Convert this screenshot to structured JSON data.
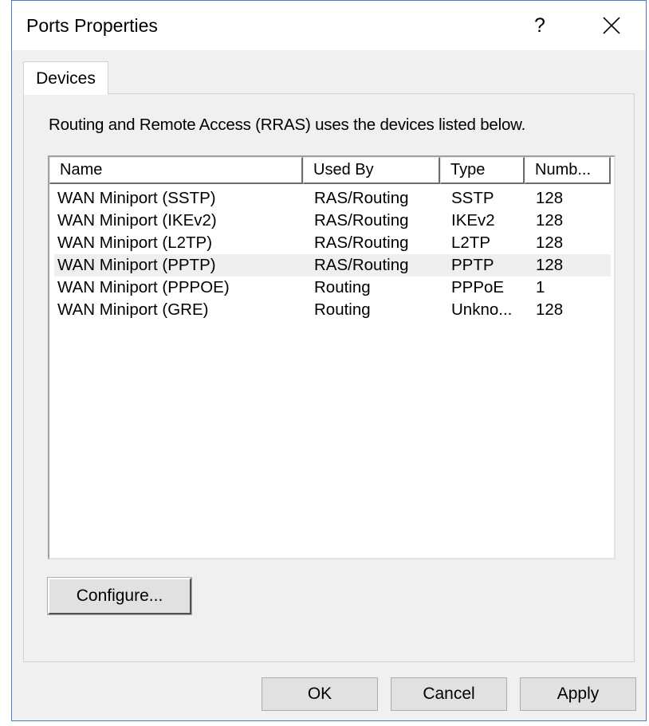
{
  "window": {
    "title": "Ports Properties",
    "help_label": "?"
  },
  "tabs": [
    {
      "label": "Devices",
      "active": true
    }
  ],
  "devices_panel": {
    "description": "Routing and Remote Access (RRAS) uses the devices listed below.",
    "columns": [
      "Name",
      "Used By",
      "Type",
      "Numb..."
    ],
    "rows": [
      {
        "name": "WAN Miniport (SSTP)",
        "used_by": "RAS/Routing",
        "type": "SSTP",
        "number": "128",
        "selected": false
      },
      {
        "name": "WAN Miniport (IKEv2)",
        "used_by": "RAS/Routing",
        "type": "IKEv2",
        "number": "128",
        "selected": false
      },
      {
        "name": "WAN Miniport (L2TP)",
        "used_by": "RAS/Routing",
        "type": "L2TP",
        "number": "128",
        "selected": false
      },
      {
        "name": "WAN Miniport (PPTP)",
        "used_by": "RAS/Routing",
        "type": "PPTP",
        "number": "128",
        "selected": true
      },
      {
        "name": "WAN Miniport (PPPOE)",
        "used_by": "Routing",
        "type": "PPPoE",
        "number": "1",
        "selected": false
      },
      {
        "name": "WAN Miniport (GRE)",
        "used_by": "Routing",
        "type": "Unkno...",
        "number": "128",
        "selected": false
      }
    ],
    "configure_label": "Configure..."
  },
  "footer": {
    "ok_label": "OK",
    "cancel_label": "Cancel",
    "apply_label": "Apply"
  },
  "icons": {
    "close": "close-icon"
  }
}
